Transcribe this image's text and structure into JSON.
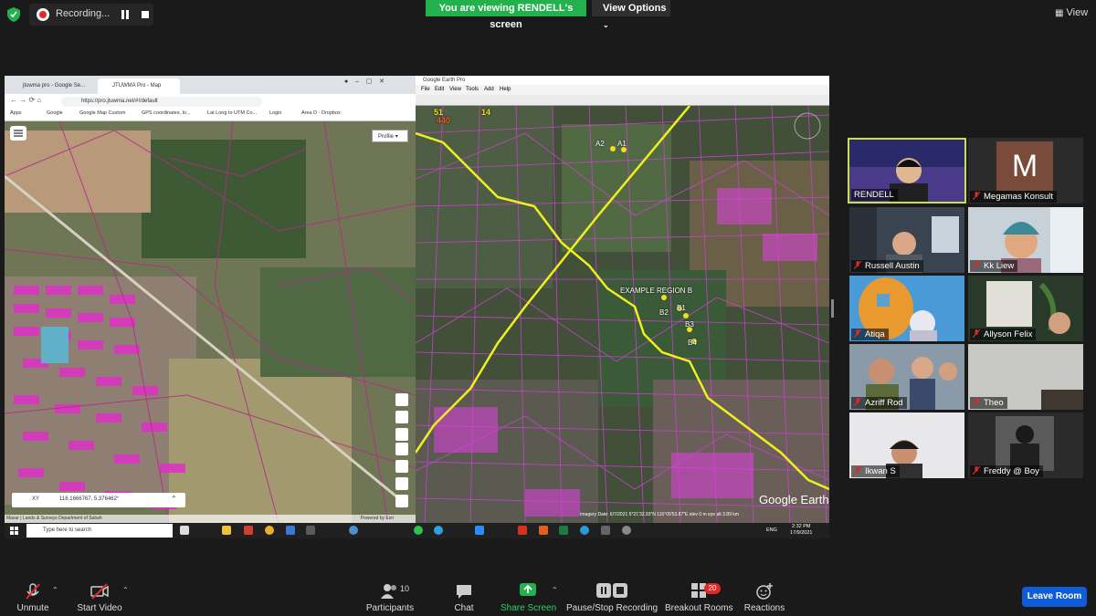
{
  "top_bar": {
    "recording_label": "Recording...",
    "viewing_banner": "You are viewing RENDELL's screen",
    "view_options": "View Options",
    "view_button": "View"
  },
  "shared_screen": {
    "browser": {
      "tab1": "jtuwma pro - Google Se...",
      "tab2": "JTUWMA Pro - Map",
      "url": "https://pro.jtuwma.net/#!/default",
      "bookmarks": [
        "Apps",
        "Google",
        "Google Map Custom",
        "GPS coordinates, lo...",
        "Lat Long to UTM Co...",
        "Login",
        "Area D - Dropbox"
      ],
      "profile_button": "Profile",
      "xy_label": "XY",
      "xy_value": "116.1666767, 5.376462°",
      "attribution": "Maxar | Lands & Surveys Department of Sabah",
      "attribution_right": "Powered by Esri"
    },
    "google_earth": {
      "window_title": "Google Earth Pro",
      "menu": [
        "File",
        "Edit",
        "View",
        "Tools",
        "Add",
        "Help"
      ],
      "labels": {
        "a2": "A2",
        "a1": "A1",
        "region": "EXAMPLE REGION B",
        "b2": "B2",
        "b1": "B1",
        "b3": "B3",
        "b4": "B4"
      },
      "hud_top": "51",
      "hud_bottom": "440",
      "hud_right": "14",
      "status": "Imagery Date: 6/7/2021   5°21'32.93\"N 116°09'53.87\"E  elev   0 m   eye alt   3.89 km",
      "logo": "Google Earth"
    },
    "taskbar": {
      "search_placeholder": "Type here to search",
      "lang": "ENG",
      "time": "2:32 PM",
      "date": "17/9/2021"
    }
  },
  "participants": [
    {
      "name": "RENDELL",
      "muted": false,
      "active": true
    },
    {
      "name": "Megamas Konsult",
      "muted": true,
      "avatar_letter": "M"
    },
    {
      "name": "Russell Austin",
      "muted": true
    },
    {
      "name": "Kk Liew",
      "muted": true
    },
    {
      "name": "Atiqa",
      "muted": true
    },
    {
      "name": "Allyson Felix",
      "muted": true
    },
    {
      "name": "Azriff Rod",
      "muted": true
    },
    {
      "name": "Theo",
      "muted": true
    },
    {
      "name": "Ikwan S",
      "muted": true
    },
    {
      "name": "Freddy @ Boy",
      "muted": true
    }
  ],
  "toolbar": {
    "unmute": "Unmute",
    "start_video": "Start Video",
    "participants": "Participants",
    "participants_count": "10",
    "chat": "Chat",
    "share_screen": "Share Screen",
    "pause_stop": "Pause/Stop Recording",
    "breakout": "Breakout Rooms",
    "breakout_badge": "20",
    "reactions": "Reactions",
    "leave": "Leave Room"
  },
  "colors": {
    "green_banner": "#23b14d",
    "leave_blue": "#0e5cd8",
    "active_border": "#c8e04a",
    "parcel_magenta": "#e040e0",
    "boundary_yellow": "#f0f020"
  }
}
